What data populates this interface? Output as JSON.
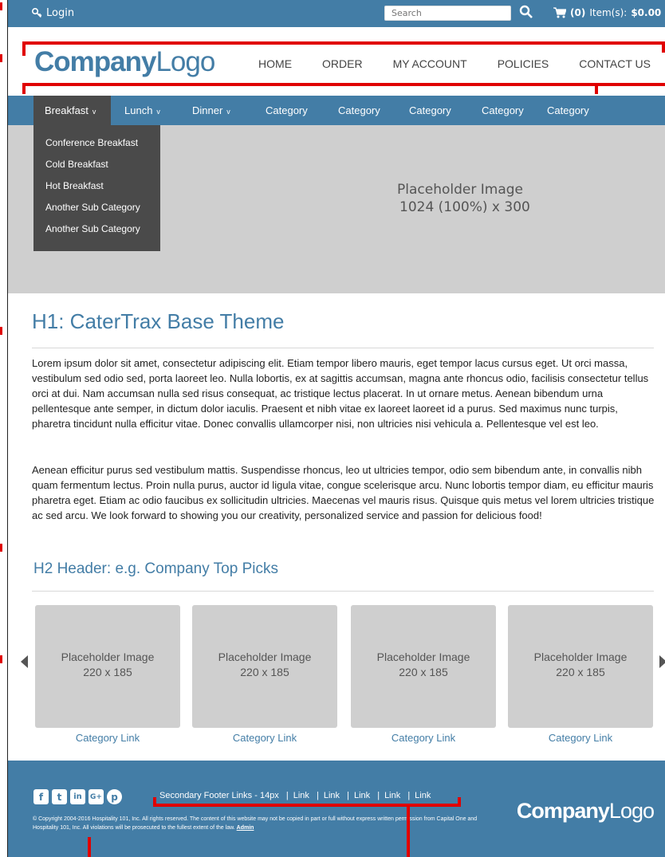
{
  "topbar": {
    "login_label": "Login",
    "search_placeholder": "Search",
    "cart_count": "(0)",
    "cart_items_label": "Item(s):",
    "cart_total": "$0.00"
  },
  "header": {
    "logo_bold": "Company",
    "logo_light": "Logo",
    "nav": [
      "HOME",
      "ORDER",
      "MY ACCOUNT",
      "POLICIES",
      "CONTACT US"
    ]
  },
  "catnav": {
    "items": [
      "Breakfast",
      "Lunch",
      "Dinner",
      "Category",
      "Category",
      "Category",
      "Category",
      "Category"
    ],
    "caret": "v"
  },
  "dropdown": {
    "items": [
      "Conference Breakfast",
      "Cold Breakfast",
      "Hot Breakfast",
      "Another Sub Category",
      "Another Sub Category"
    ]
  },
  "hero": {
    "line1": "Placeholder Image",
    "line2": "1024 (100%) x 300"
  },
  "content": {
    "h1": "H1: CaterTrax Base Theme",
    "para1": "Lorem ipsum dolor sit amet, consectetur adipiscing elit. Etiam tempor libero mauris, eget tempor lacus cursus eget. Ut orci massa, vestibulum sed odio sed, porta laoreet leo. Nulla lobortis, ex at sagittis accumsan, magna ante rhoncus odio, facilisis consectetur tellus orci at dui. Nam accumsan nulla sed risus consequat, ac tristique lectus placerat. In ut ornare metus. Aenean bibendum urna pellentesque ante semper, in dictum dolor iaculis. Praesent et nibh vitae ex laoreet laoreet id a purus. Sed maximus nunc turpis, pharetra tincidunt nulla efficitur vitae. Donec convallis ullamcorper nisi, non ultricies nisi vehicula a. Pellentesque vel est leo.",
    "para2": "Aenean efficitur purus sed vestibulum mattis. Suspendisse rhoncus, leo ut ultricies tempor, odio sem bibendum ante, in convallis nibh quam fermentum lectus. Proin nulla purus, auctor id ligula vitae, congue scelerisque arcu. Nunc lobortis tempor diam, eu efficitur mauris pharetra eget. Etiam ac odio faucibus ex sollicitudin ultricies. Maecenas vel mauris risus. Quisque quis metus vel lorem ultricies tristique ac sed arcu. We look forward to showing you our creativity, personalized service and passion for delicious food!",
    "h2": "H2 Header: e.g. Company Top Picks"
  },
  "carousel": {
    "cards": [
      {
        "ph1": "Placeholder Image",
        "ph2": "220 x 185",
        "link": "Category Link"
      },
      {
        "ph1": "Placeholder Image",
        "ph2": "220 x 185",
        "link": "Category Link"
      },
      {
        "ph1": "Placeholder Image",
        "ph2": "220 x 185",
        "link": "Category Link"
      },
      {
        "ph1": "Placeholder Image",
        "ph2": "220 x 185",
        "link": "Category Link"
      }
    ]
  },
  "footer": {
    "social": [
      "f",
      "t",
      "in",
      "G+",
      "p"
    ],
    "secondary_label": "Secondary Footer Links - 14px",
    "links": [
      "Link",
      "Link",
      "Link",
      "Link",
      "Link"
    ],
    "copyright": "© Copyright 2004-2016 Hospitality 101, Inc. All rights reserved. The content of this website may not be copied in part or full without express written permission from Capital One and Hospitality 101, Inc. All violations will be prosecuted to the fullest extent of the law.",
    "admin_link": "Admin",
    "logo_bold": "Company",
    "logo_light": "Logo"
  },
  "colors": {
    "brand_blue": "#437da6",
    "dropdown_bg": "#4a4a4a",
    "placeholder_gray": "#cfcfcf",
    "annotation_red": "#e00000"
  }
}
